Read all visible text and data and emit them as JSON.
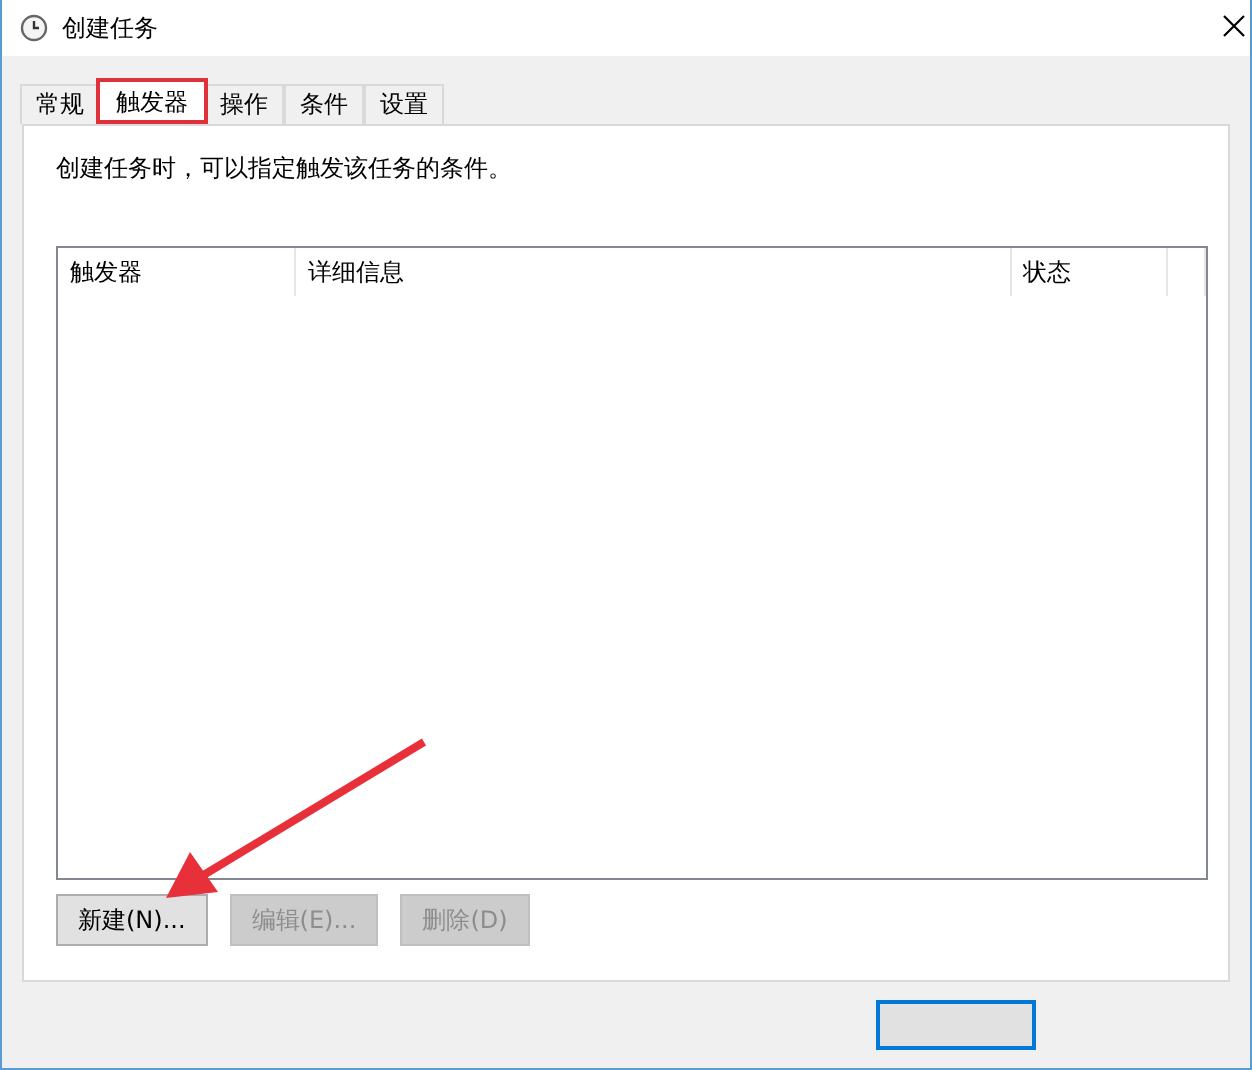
{
  "window": {
    "title": "创建任务"
  },
  "tabs": [
    {
      "label": "常规",
      "selected": false,
      "highlighted": false
    },
    {
      "label": "触发器",
      "selected": true,
      "highlighted": true
    },
    {
      "label": "操作",
      "selected": false,
      "highlighted": false
    },
    {
      "label": "条件",
      "selected": false,
      "highlighted": false
    },
    {
      "label": "设置",
      "selected": false,
      "highlighted": false
    }
  ],
  "description": "创建任务时，可以指定触发该任务的条件。",
  "table": {
    "columns": [
      "触发器",
      "详细信息",
      "状态"
    ]
  },
  "buttons": [
    {
      "label": "新建(N)...",
      "disabled": false
    },
    {
      "label": "编辑(E)...",
      "disabled": true
    },
    {
      "label": "删除(D)",
      "disabled": true
    }
  ]
}
